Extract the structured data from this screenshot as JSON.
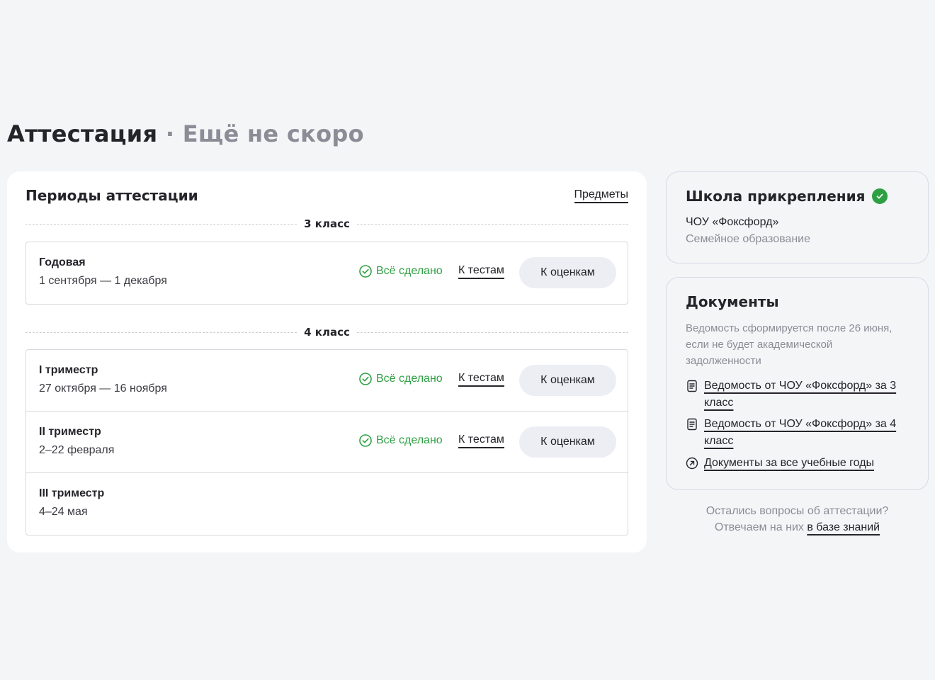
{
  "header": {
    "title": "Аттестация",
    "separator": "·",
    "subtitle": "Ещё не скоро"
  },
  "periods_card": {
    "title": "Периоды аттестации",
    "subjects_link": "Предметы",
    "grades": [
      {
        "label": "3 класс",
        "periods": [
          {
            "name": "Годовая",
            "dates": "1 сентября — 1 декабря",
            "status": "Всё сделано",
            "tests_link": "К тестам",
            "grades_button": "К оценкам"
          }
        ]
      },
      {
        "label": "4 класс",
        "periods": [
          {
            "name": "I триместр",
            "dates": "27 октября — 16 ноября",
            "status": "Всё сделано",
            "tests_link": "К тестам",
            "grades_button": "К оценкам"
          },
          {
            "name": "II триместр",
            "dates": "2–22 февраля",
            "status": "Всё сделано",
            "tests_link": "К тестам",
            "grades_button": "К оценкам"
          },
          {
            "name": "III триместр",
            "dates": "4–24 мая"
          }
        ]
      }
    ]
  },
  "school_card": {
    "title": "Школа прикрепления",
    "school_name": "ЧОУ «Фоксфорд»",
    "education_type": "Семейное образование"
  },
  "documents_card": {
    "title": "Документы",
    "note": "Ведомость сформируется после 26 июня, если не будет академической задолженности",
    "items": [
      {
        "label": "Ведомость от ЧОУ «Фоксфорд» за 3 класс",
        "icon": "document-icon"
      },
      {
        "label": "Ведомость от ЧОУ «Фоксфорд» за 4 класс",
        "icon": "document-icon"
      },
      {
        "label": "Документы за все учебные годы",
        "icon": "arrow-up-right-circle-icon"
      }
    ]
  },
  "help": {
    "line1": "Остались вопросы об аттестации?",
    "line2_prefix": "Отвечаем на них",
    "link": "в базе знаний"
  },
  "colors": {
    "success": "#2ea043",
    "muted": "#8b8c96",
    "text": "#24242a",
    "background": "#f4f5f7",
    "button_bg": "#eceef4"
  }
}
